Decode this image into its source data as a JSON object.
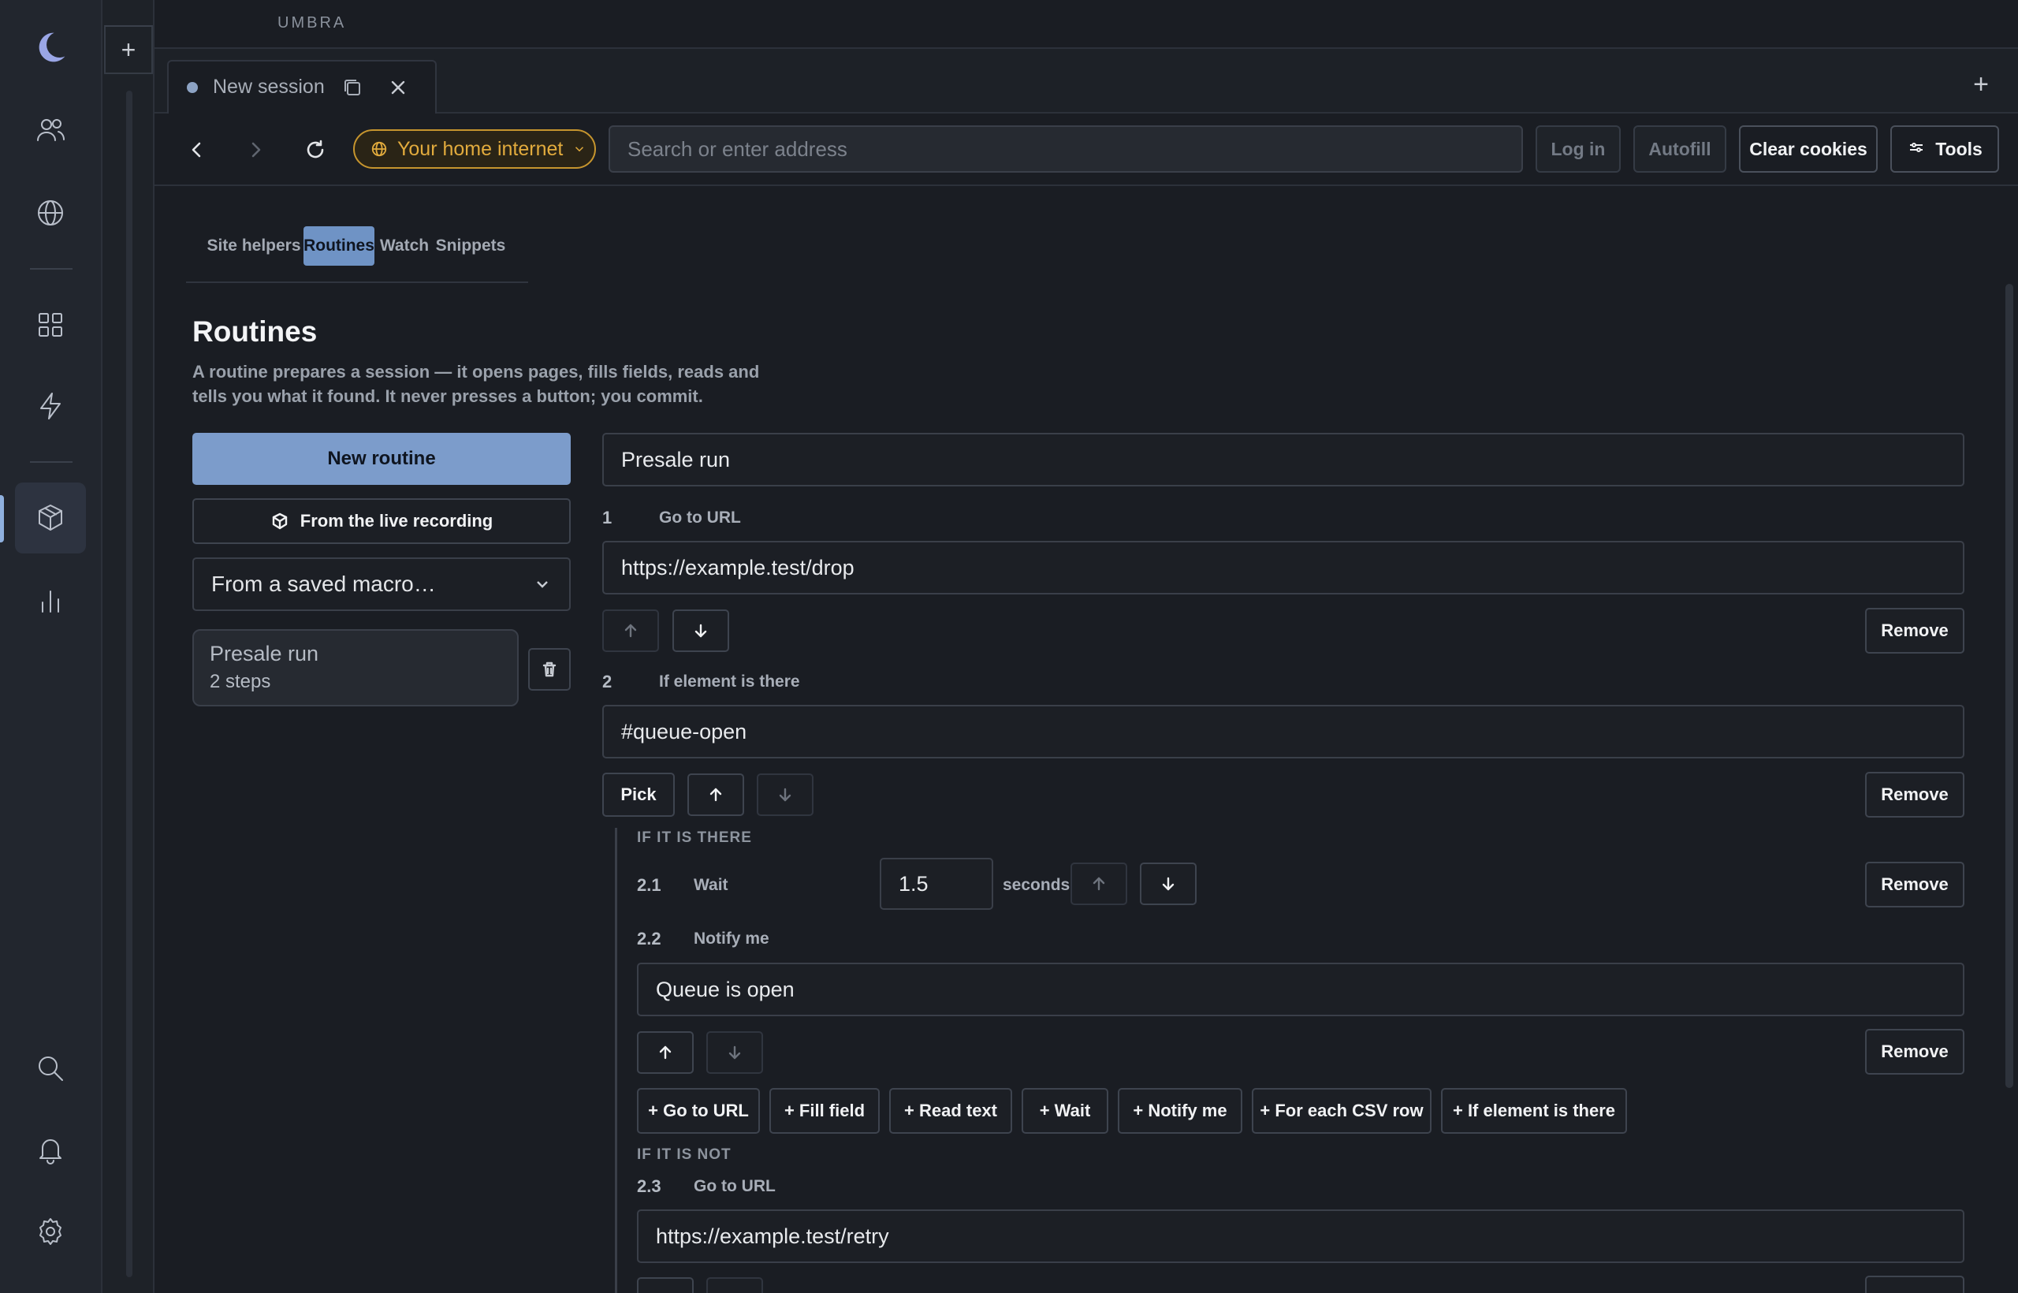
{
  "app": {
    "brand": "UMBRA"
  },
  "rail": {
    "icons": [
      "moon-logo-icon",
      "people-icon",
      "globe-icon",
      "grid-icon",
      "bolt-icon",
      "cube-icon",
      "bar-chart-icon",
      "search-icon",
      "bell-icon",
      "gear-icon"
    ],
    "active": "cube-icon"
  },
  "tabs": [
    {
      "title": "New session"
    }
  ],
  "navbar": {
    "network_label": "Your home internet",
    "address_placeholder": "Search or enter address",
    "address_value": "",
    "login_label": "Log in",
    "autofill_label": "Autofill",
    "clear_cookies_label": "Clear cookies",
    "tools_label": "Tools"
  },
  "subtabs": [
    "Site helpers",
    "Routines",
    "Watch",
    "Snippets"
  ],
  "active_subtab": "Routines",
  "page": {
    "title": "Routines",
    "description": "A routine prepares a session — it opens pages, fills fields, reads and tells you what it found. It never presses a button; you commit."
  },
  "sidebar": {
    "new_routine_label": "New routine",
    "from_recording_label": "From the live recording",
    "saved_macro_select": "From a saved macro…",
    "routines": [
      {
        "name": "Presale run",
        "steps": "2 steps"
      }
    ]
  },
  "editor": {
    "routine_name": "Presale run",
    "steps": [
      {
        "num": "1",
        "type": "Go to URL",
        "value": "https://example.test/drop"
      },
      {
        "num": "2",
        "type": "If element is there",
        "value": "#queue-open",
        "pick_label": "Pick"
      }
    ],
    "branch_then_label": "IF IT IS THERE",
    "then_steps": [
      {
        "num": "2.1",
        "type": "Wait",
        "value": "1.5",
        "unit": "seconds"
      },
      {
        "num": "2.2",
        "type": "Notify me",
        "value": "Queue is open"
      }
    ],
    "add_buttons": [
      "+ Go to URL",
      "+ Fill field",
      "+ Read text",
      "+ Wait",
      "+ Notify me",
      "+ For each CSV row",
      "+ If element is there"
    ],
    "branch_else_label": "IF IT IS NOT",
    "else_steps": [
      {
        "num": "2.3",
        "type": "Go to URL",
        "value": "https://example.test/retry"
      }
    ],
    "remove_label": "Remove"
  },
  "colors": {
    "accent": "#7c9ccb",
    "network_amber": "#e2ab3d",
    "background": "#1a1d23"
  }
}
